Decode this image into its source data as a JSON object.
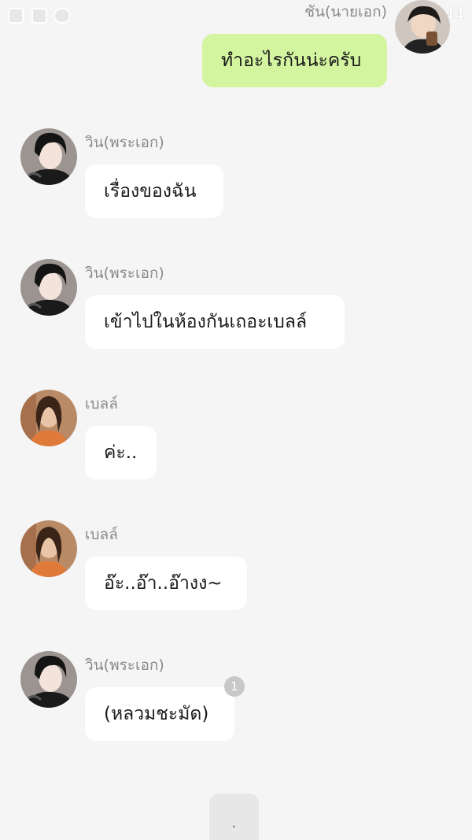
{
  "status_bar": {
    "time": "14:44",
    "icons": [
      "gallery-icon",
      "facebook-icon",
      "chat-app-icon",
      "alarm-icon",
      "battery-icon"
    ]
  },
  "messages": [
    {
      "side": "right",
      "sender": "ชัน(นายเอก)",
      "text": "ทำอะไรกันน่ะครับ",
      "avatar": "avatar-chan"
    },
    {
      "side": "left",
      "sender": "วิน(พระเอก)",
      "text": "เรื่องของฉัน",
      "avatar": "avatar-win"
    },
    {
      "side": "left",
      "sender": "วิน(พระเอก)",
      "text": "เข้าไปในห้องกันเถอะเบลล์",
      "avatar": "avatar-win"
    },
    {
      "side": "left",
      "sender": "เบลล์",
      "text": "ค่ะ..",
      "avatar": "avatar-belle"
    },
    {
      "side": "left",
      "sender": "เบลล์",
      "text": "อ๊ะ..อ๊า..อ๊างง~",
      "avatar": "avatar-belle"
    },
    {
      "side": "left",
      "sender": "วิน(พระเอก)",
      "text": "(หลวมชะมัด)",
      "avatar": "avatar-win",
      "unread_count": "1"
    }
  ],
  "bottom_button": {
    "label": "."
  },
  "colors": {
    "background": "#f5f5f5",
    "mine_bubble": "#d4f5a0",
    "other_bubble": "#ffffff",
    "sender_name": "#8a8a8a",
    "badge": "#c8c8c8"
  }
}
